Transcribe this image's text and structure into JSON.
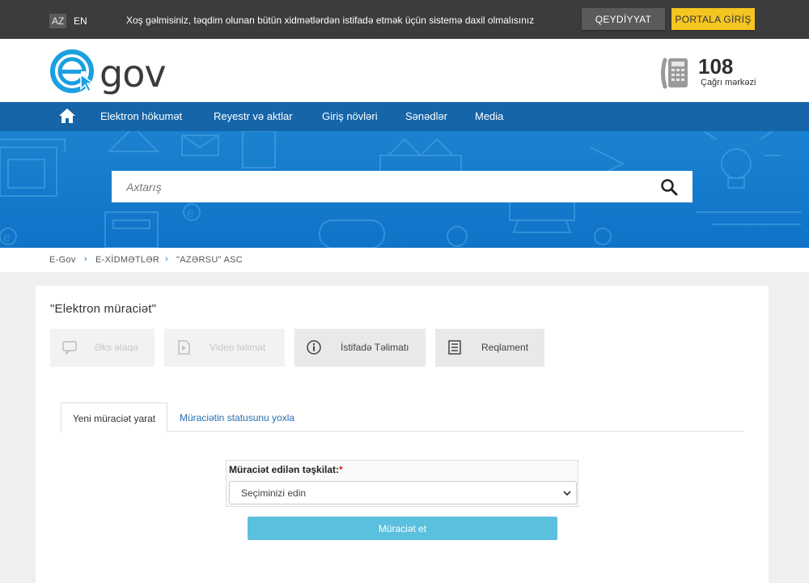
{
  "topbar": {
    "lang_az": "AZ",
    "lang_en": "EN",
    "welcome": "Xoş gəlmisiniz, təqdim olunan bütün xidmətlərdən istifadə etmək üçün sistemə daxil olmalısınız",
    "register_label": "QEYDİYYAT",
    "login_label": "PORTALA GİRİŞ"
  },
  "header": {
    "logo_text": "gov",
    "callcenter_number": "108",
    "callcenter_label": "Çağrı mərkəzi"
  },
  "nav": {
    "items": [
      "Elektron hökumət",
      "Reyestr və aktlar",
      "Giriş növləri",
      "Sənədlər",
      "Media"
    ]
  },
  "search": {
    "placeholder": "Axtarış"
  },
  "breadcrumb": {
    "items": [
      "E-Gov",
      "E-XİDMƏTLƏR",
      "\"AZƏRSU\" ASC"
    ]
  },
  "card": {
    "title": "\"Elektron müraciət\"",
    "tools": [
      "Əks əlaqə",
      "Video təlimat",
      "İstifadə Təlimatı",
      "Reqlament"
    ],
    "tabs": [
      "Yeni müraciət yarat",
      "Müraciətin statusunu yoxla"
    ],
    "field_label": "Müraciət edilən təşkilat:",
    "required_mark": "*",
    "select_value": "Seçiminizi edin",
    "submit_label": "Müraciət et"
  },
  "colors": {
    "topbar": "#3c3c3c",
    "nav": "#1565a8",
    "banner": "#0f73c8",
    "login_button": "#f5c522",
    "submit_button": "#5bc0de",
    "logo_blue": "#1aa0e0"
  }
}
